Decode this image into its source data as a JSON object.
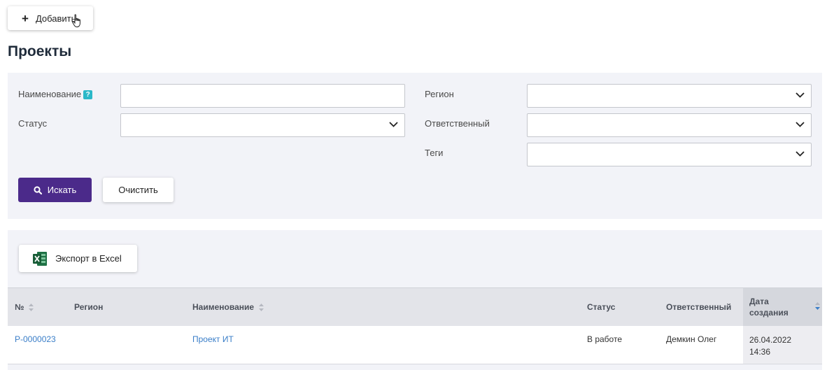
{
  "toolbar": {
    "add_label": "Добавить"
  },
  "page": {
    "title": "Проекты"
  },
  "filters": {
    "name_label": "Наименование",
    "help_badge": "?",
    "status_label": "Статус",
    "region_label": "Регион",
    "responsible_label": "Ответственный",
    "tags_label": "Теги",
    "name_value": "",
    "search_label": "Искать",
    "clear_label": "Очистить"
  },
  "results": {
    "export_label": "Экспорт в Excel",
    "columns": {
      "num": "№",
      "region": "Регион",
      "name": "Наименование",
      "status": "Статус",
      "responsible": "Ответственный",
      "date_line1": "Дата",
      "date_line2": "создания"
    },
    "rows": [
      {
        "num": "Р-0000023",
        "region": "",
        "name": "Проект ИТ",
        "status": "В работе",
        "responsible": "Демкин Олег",
        "date": "26.04.2022",
        "time": "14:36"
      }
    ]
  },
  "colors": {
    "primary": "#4b2a8a",
    "link": "#3a7ec8",
    "panel": "#f2f3f8",
    "help": "#2bb8c8",
    "sort_active": "#3a7ec8"
  }
}
